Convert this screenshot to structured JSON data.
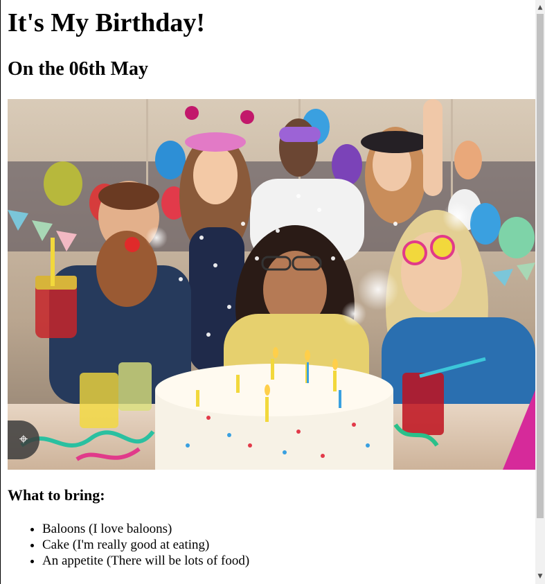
{
  "page": {
    "title": "It's My Birthday!",
    "date_heading": "On the 06th May"
  },
  "photo": {
    "alt": "Group of friends celebrating a birthday with a cake, balloons and confetti",
    "lens_icon": "camera-lens-icon"
  },
  "bring": {
    "heading": "What to bring:",
    "items": [
      "Baloons (I love baloons)",
      "Cake (I'm really good at eating)",
      "An appetite (There will be lots of food)"
    ]
  },
  "scrollbar": {
    "up_icon": "scroll-up-arrow-icon",
    "down_icon": "scroll-down-arrow-icon"
  }
}
